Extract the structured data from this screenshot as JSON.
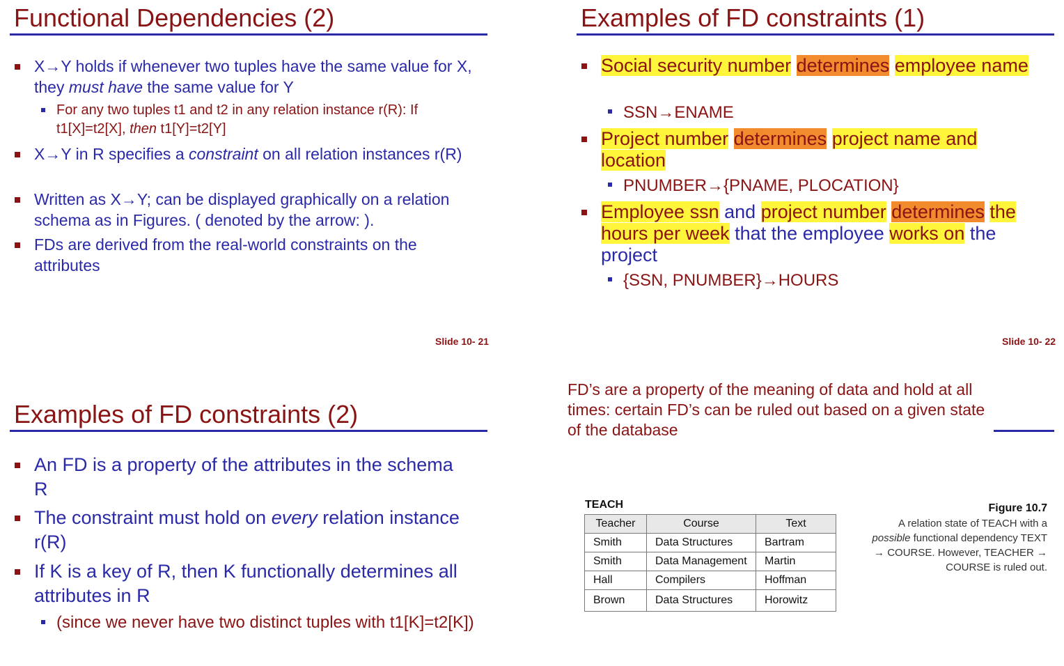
{
  "slide1": {
    "title": "Functional Dependencies (2)",
    "b1_a": "X→Y holds if whenever two tuples have the same value for X, they ",
    "b1_em": "must have",
    "b1_b": " the same value for Y",
    "s1_a": "For any two tuples t1 and t2 in any relation instance r(R): If t1[X]=t2[X], ",
    "s1_em": "then",
    "s1_b": " t1[Y]=t2[Y]",
    "b2_a": "X→Y in R specifies a ",
    "b2_em": "constraint",
    "b2_b": " on all relation instances r(R)",
    "b3": "Written as X→Y; can be displayed graphically on a relation schema as in Figures. ( denoted by the arrow: ).",
    "b4": "FDs are derived from the real-world constraints on the attributes",
    "slide_no": "Slide 10- 21"
  },
  "slide2": {
    "title": "Examples of FD constraints (1)",
    "b1_p1": "Social security number",
    "b1_p2": "determines",
    "b1_p3": "employee name",
    "s1": "SSN→ENAME",
    "b2_p1": "Project number",
    "b2_p2": "determines",
    "b2_p3": "project name and location",
    "s2": "PNUMBER→{PNAME, PLOCATION}",
    "b3_p1": "Employee ssn",
    "b3_p2": "and",
    "b3_p3": "project number",
    "b3_p4": "determines",
    "b3_p5": "the hours per week",
    "b3_p6": "that the employee",
    "b3_p7": "works on",
    "b3_p8": "the project",
    "s3": "{SSN, PNUMBER}→HOURS",
    "slide_no": "Slide 10- 22"
  },
  "slide3": {
    "title": "Examples of FD constraints (2)",
    "b1": "An FD is a property of the attributes in the schema R",
    "b2_a": "The constraint must hold on ",
    "b2_em": "every",
    "b2_b": " relation instance r(R)",
    "b3": "If K is a key of R, then K functionally determines all attributes in R",
    "s1": "(since we never have two distinct tuples with t1[K]=t2[K])"
  },
  "slide4": {
    "note": "FD’s are a property of the meaning of data and hold at all times: certain FD’s can be ruled out based on a given state of the database",
    "table_label": "TEACH",
    "headers": [
      "Teacher",
      "Course",
      "Text"
    ],
    "rows": [
      [
        "Smith",
        "Data Structures",
        "Bartram"
      ],
      [
        "Smith",
        "Data Management",
        "Martin"
      ],
      [
        "Hall",
        "Compilers",
        "Hoffman"
      ],
      [
        "Brown",
        "Data Structures",
        "Horowitz"
      ]
    ],
    "fig_title": "Figure 10.7",
    "cap_a": "A relation state of TEACH with a ",
    "cap_em": "possible",
    "cap_b": " functional dependency TEXT → COURSE. However, TEACHER → COURSE is ruled out."
  }
}
